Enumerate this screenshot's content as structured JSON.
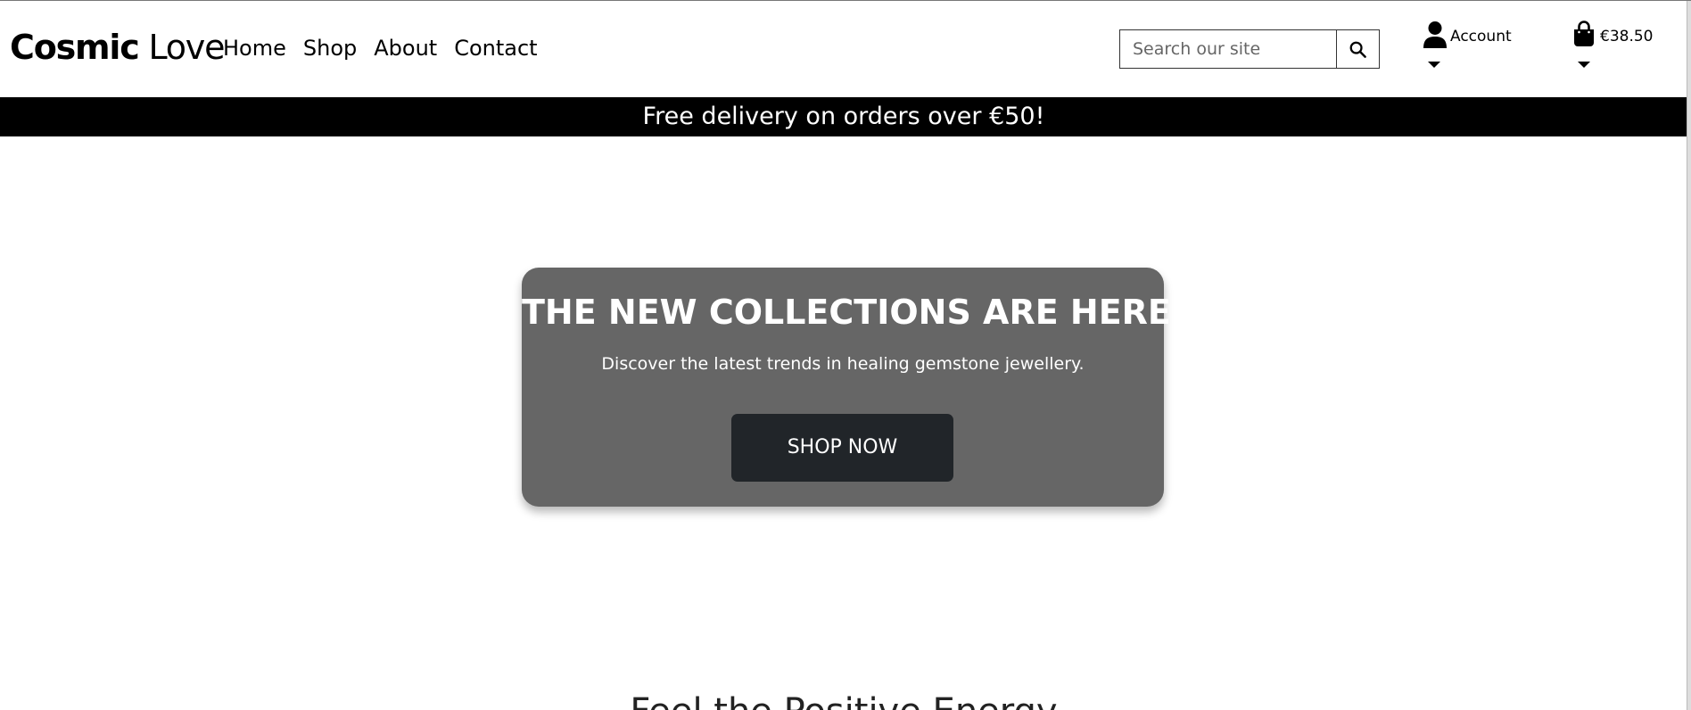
{
  "header": {
    "logo_bold": "Cosmic",
    "logo_regular": " Love",
    "nav": [
      {
        "label": "Home"
      },
      {
        "label": "Shop"
      },
      {
        "label": "About"
      },
      {
        "label": "Contact"
      }
    ],
    "search": {
      "placeholder": "Search our site",
      "value": "",
      "icon": "search-icon"
    },
    "account": {
      "label": "Account",
      "icon": "user-icon"
    },
    "cart": {
      "total": "€38.50",
      "icon": "shopping-bag-icon"
    }
  },
  "banner": {
    "text": "Free delivery on orders over €50!"
  },
  "hero": {
    "title": "THE NEW COLLECTIONS ARE HERE",
    "subtitle": "Discover the latest trends in healing gemstone jewellery.",
    "cta_label": "SHOP NOW"
  },
  "section": {
    "heading": "Feel the Positive Energy"
  },
  "colors": {
    "banner_bg": "#000000",
    "hero_bg": "#666666",
    "cta_bg": "#212529"
  }
}
